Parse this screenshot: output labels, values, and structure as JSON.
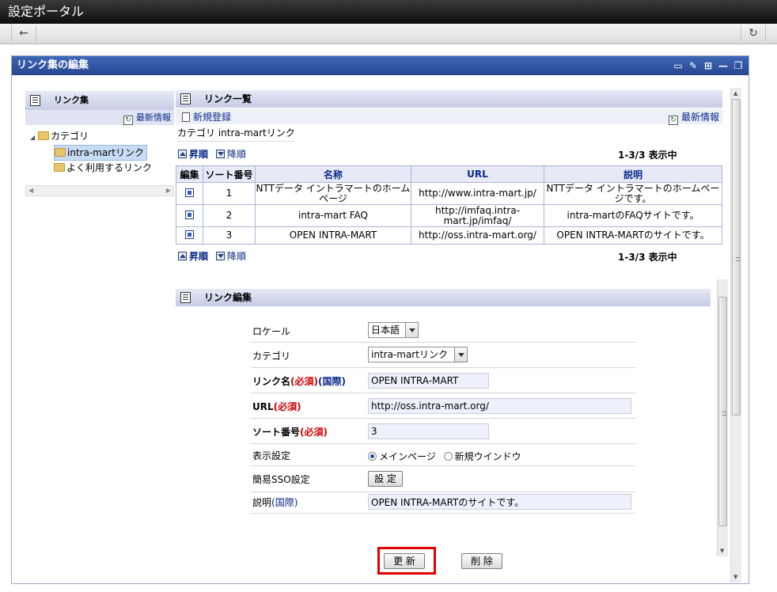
{
  "window": {
    "title": "設定ポータル"
  },
  "nav": {
    "back_icon": "←",
    "reload_icon": "↻"
  },
  "portlet": {
    "title": "リンク集の編集",
    "head_icons": [
      "monitor-icon",
      "pencil-icon",
      "settings-icon",
      "minimize-icon",
      "restore-icon"
    ]
  },
  "tree": {
    "header": "リンク集",
    "refresh_label": "最新情報",
    "root": "カテゴリ",
    "nodes": [
      "intra-martリンク",
      "よく利用するリンク"
    ]
  },
  "list": {
    "header": "リンク一覧",
    "new_label": "新規登録",
    "refresh_label": "最新情報",
    "category_line": "カテゴリ intra-martリンク",
    "sort_asc": "昇順",
    "sort_desc": "降順",
    "count_text": "1-3/3  表示中",
    "columns": [
      "編集",
      "ソート番号",
      "名称",
      "URL",
      "説明"
    ],
    "rows": [
      {
        "sort": "1",
        "name": "NTTデータ イントラマートのホームページ",
        "url": "http://www.intra-mart.jp/",
        "desc": "NTTデータ イントラマートのホームページです。"
      },
      {
        "sort": "2",
        "name": "intra-mart FAQ",
        "url": "http://imfaq.intra-mart.jp/imfaq/",
        "desc": "intra-martのFAQサイトです。"
      },
      {
        "sort": "3",
        "name": "OPEN INTRA-MART",
        "url": "http://oss.intra-mart.org/",
        "desc": "OPEN INTRA-MARTのサイトです。"
      }
    ]
  },
  "edit": {
    "header": "リンク編集",
    "locale_label": "ロケール",
    "locale_value": "日本語",
    "category_label": "カテゴリ",
    "category_value": "intra-martリンク",
    "name_label": "リンク名",
    "required": "(必須)",
    "intl": "(国際)",
    "name_value": "OPEN INTRA-MART",
    "url_label": "URL",
    "url_value": "http://oss.intra-mart.org/",
    "sort_label": "ソート番号",
    "sort_value": "3",
    "display_label": "表示設定",
    "display_opt1": "メインページ",
    "display_opt2": "新規ウインドウ",
    "sso_label": "簡易SSO設定",
    "sso_button": "設 定",
    "desc_label": "説明",
    "desc_value": "OPEN INTRA-MARTのサイトです。",
    "update_button": "更 新",
    "delete_button": "削 除"
  },
  "colors": {
    "header_blue": "#27468f",
    "required_red": "#d40000",
    "link_blue": "#0a2a8a",
    "highlight": "#e00000"
  }
}
